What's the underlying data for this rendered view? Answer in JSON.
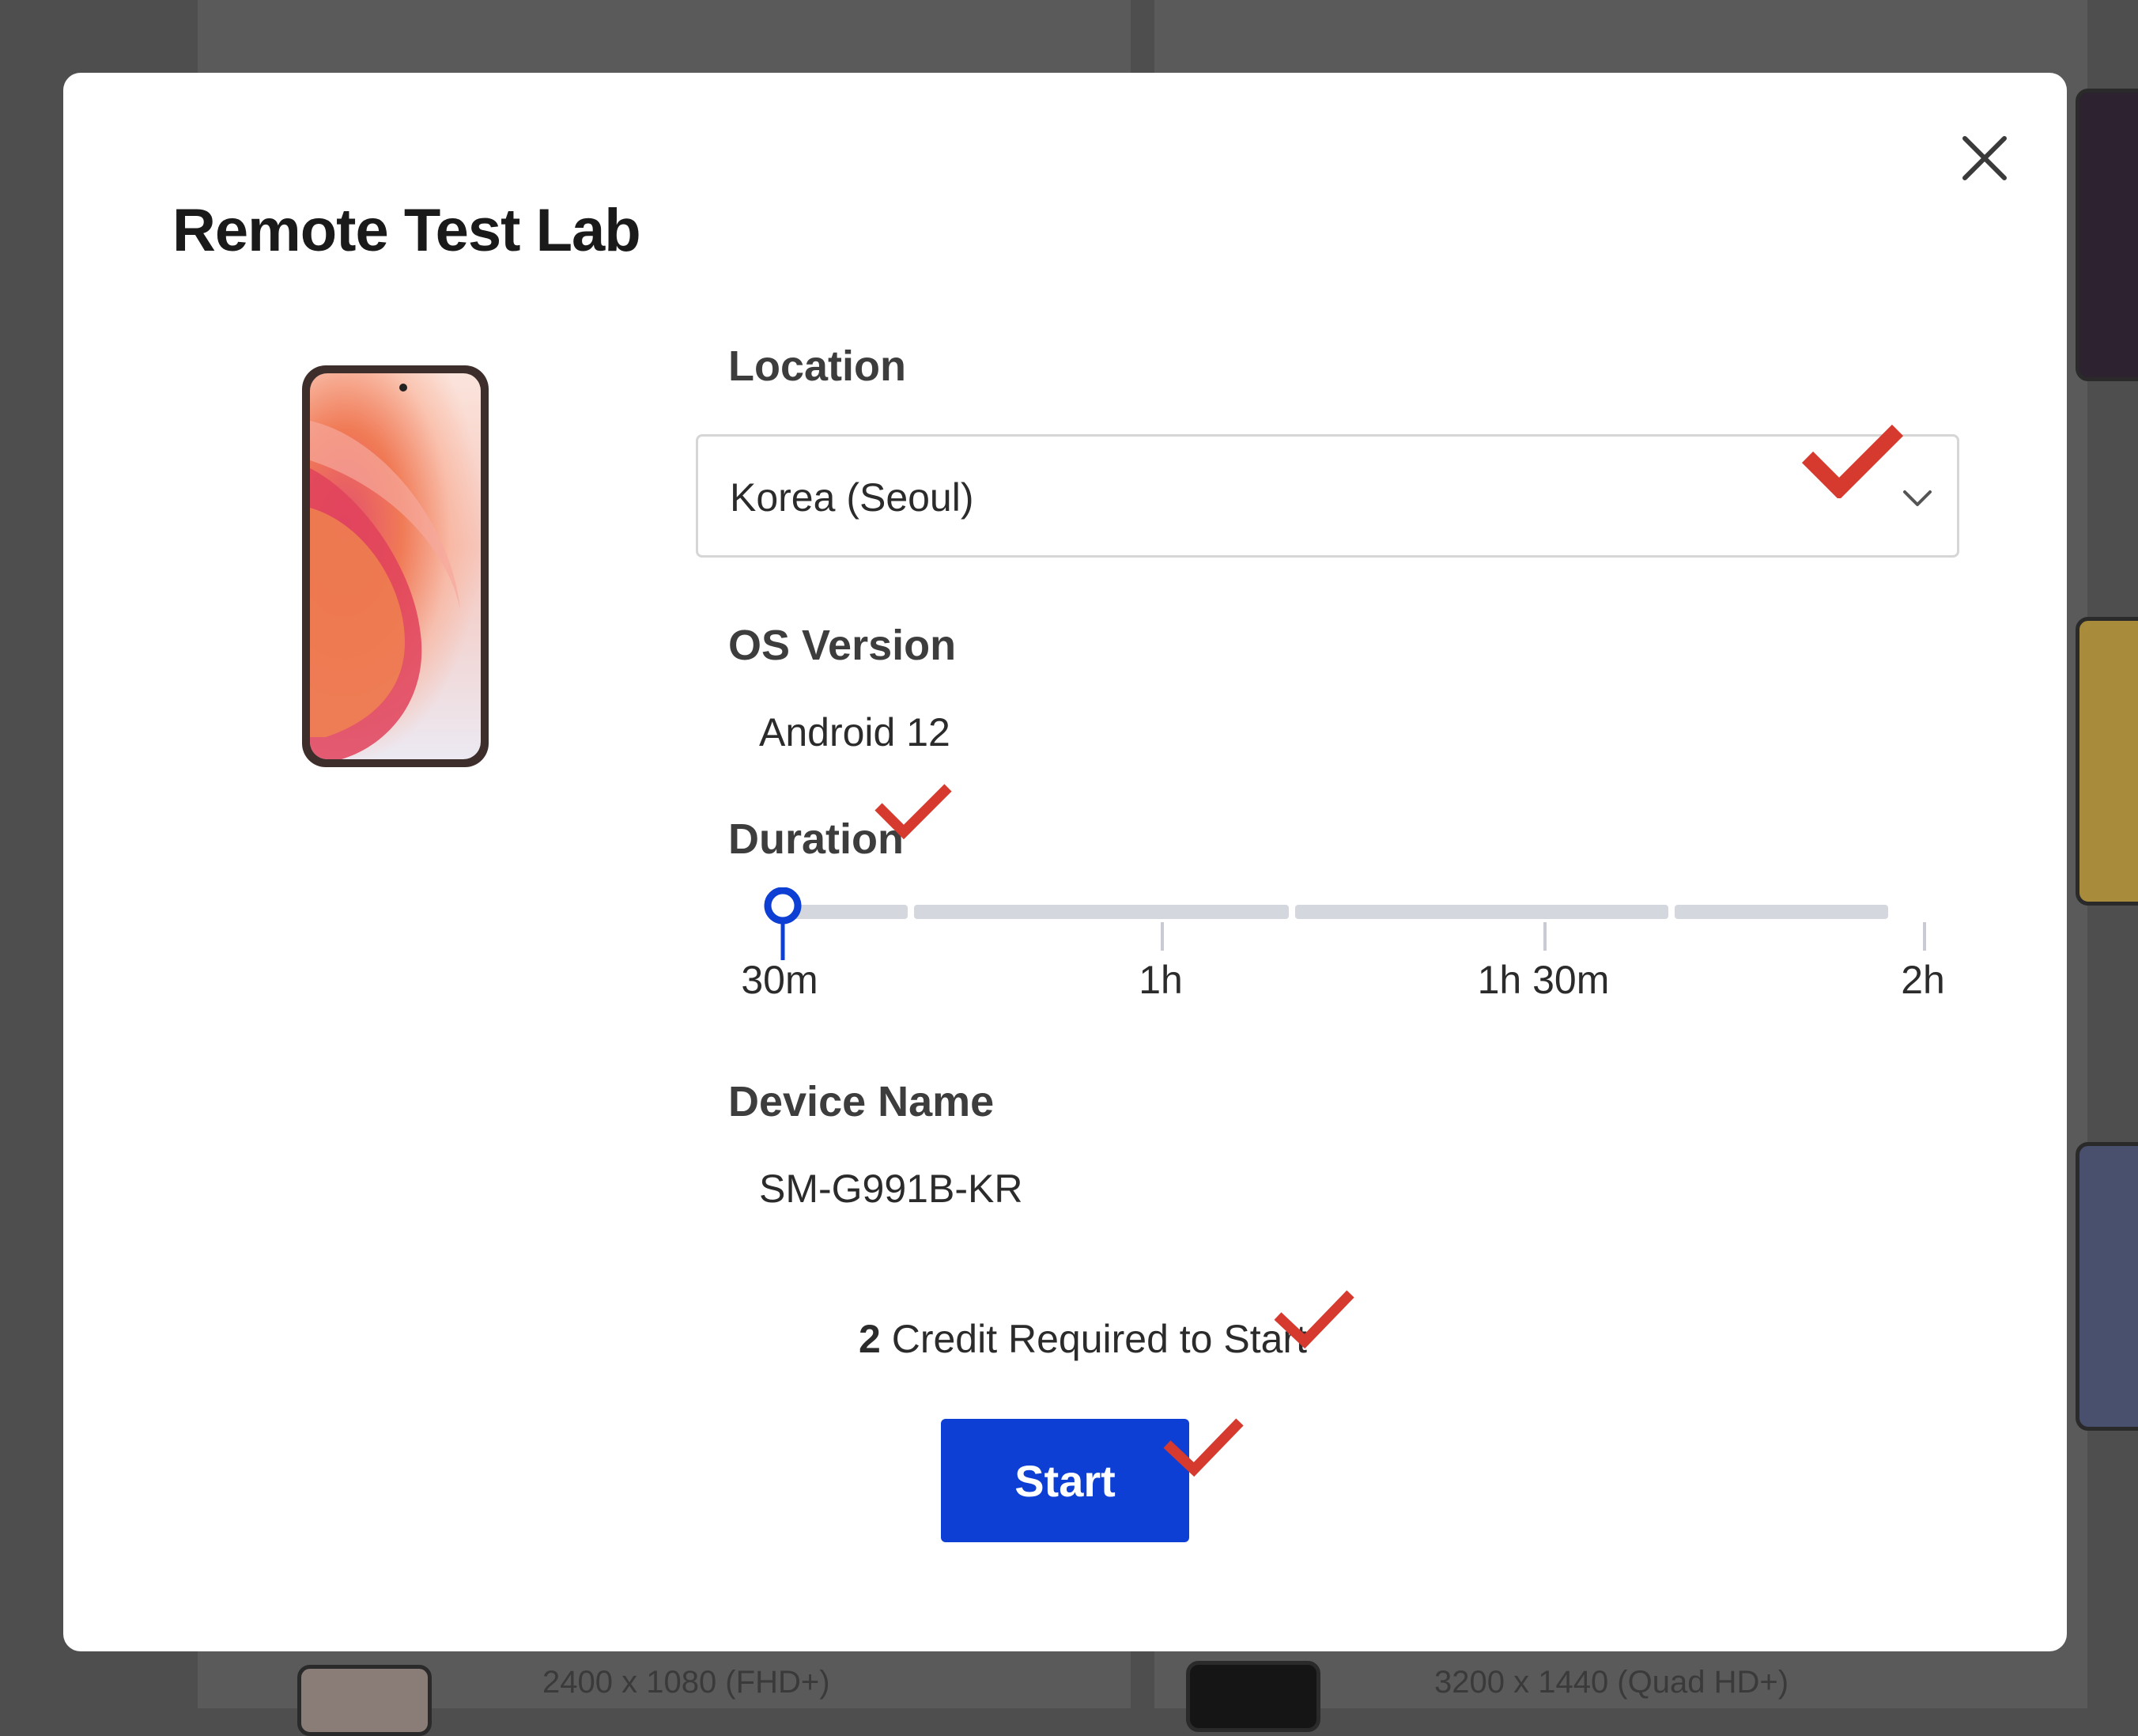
{
  "background": {
    "resolutions": [
      "2400 x 1080 (FHD+)",
      "3200 x 1440 (Quad HD+)"
    ]
  },
  "modal": {
    "title": "Remote Test Lab",
    "close_icon": "close-icon",
    "device_image": "phone-image",
    "location": {
      "label": "Location",
      "selected": "Korea (Seoul)",
      "icon": "chevron-down-icon"
    },
    "os_version": {
      "label": "OS Version",
      "value": "Android 12"
    },
    "duration": {
      "label": "Duration",
      "options": [
        "30m",
        "1h",
        "1h 30m",
        "2h"
      ],
      "selected": "30m",
      "selected_index": 0
    },
    "device_name": {
      "label": "Device Name",
      "value": "SM-G991B-KR"
    },
    "credit": {
      "count": "2",
      "text": "Credit Required to Start"
    },
    "start_label": "Start"
  },
  "annotations": {
    "check_color": "#d63a2f",
    "check_icon": "checkmark-icon"
  },
  "colors": {
    "accent": "#0d3fd4",
    "track": "#d4d7dd"
  }
}
